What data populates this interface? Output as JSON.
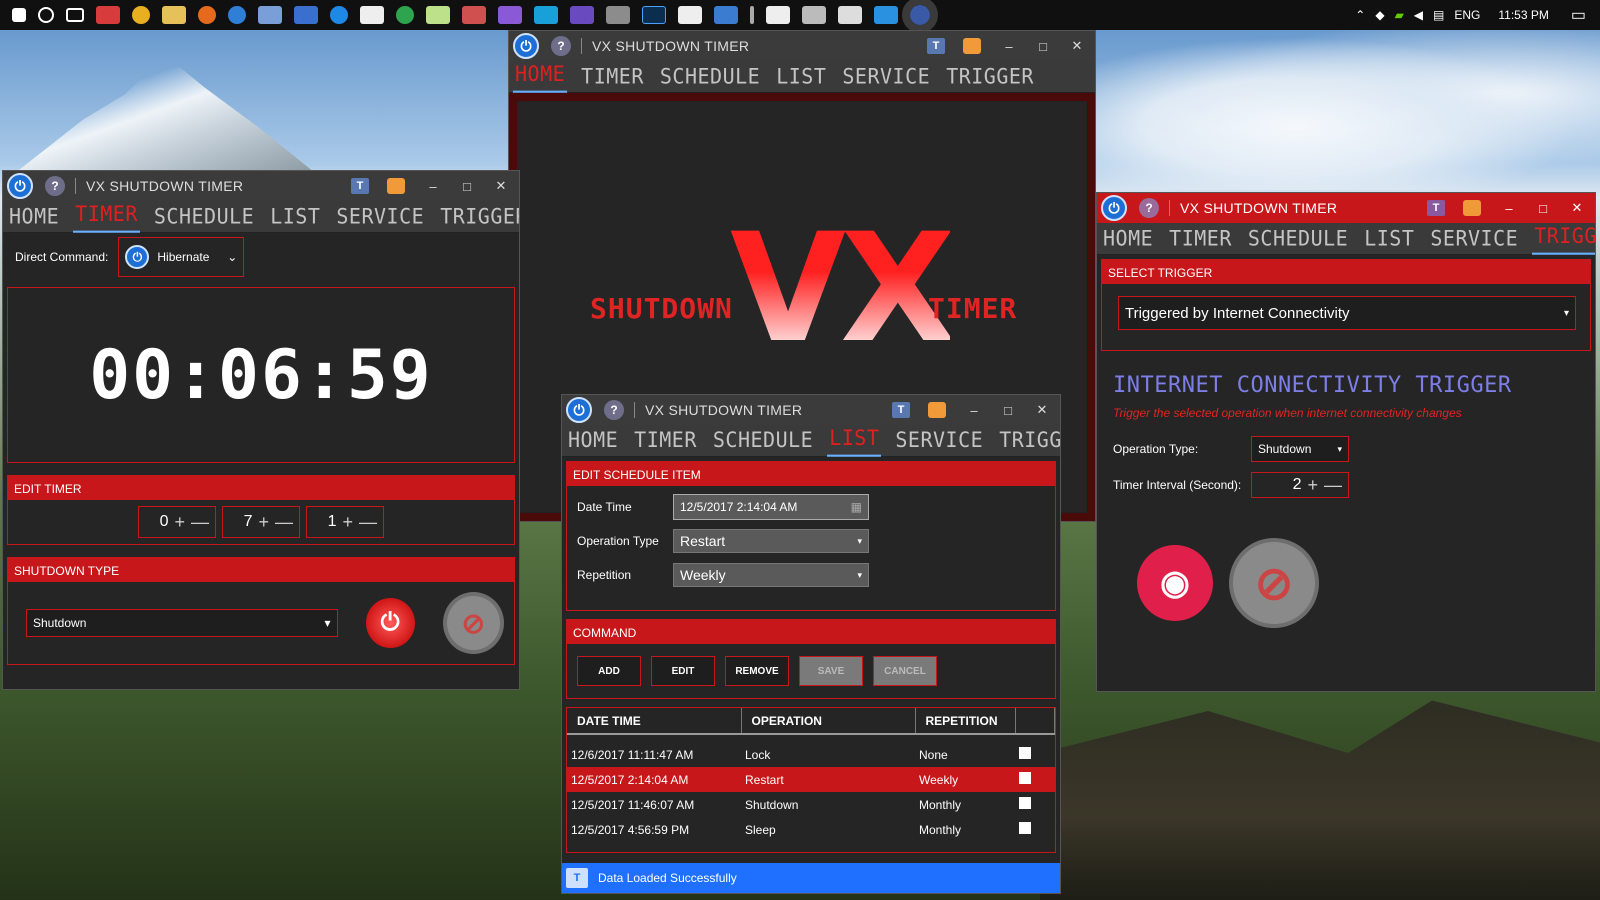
{
  "taskbar": {
    "lang": "ENG",
    "time": "11:53 PM"
  },
  "app": {
    "title": "VX SHUTDOWN TIMER",
    "nav": [
      "HOME",
      "TIMER",
      "SCHEDULE",
      "LIST",
      "SERVICE",
      "TRIGGER"
    ]
  },
  "timer_window": {
    "direct_command_label": "Direct Command:",
    "direct_command_value": "Hibernate",
    "clock": "00:06:59",
    "edit_timer_header": "EDIT TIMER",
    "hours": "0",
    "minutes": "7",
    "seconds": "1",
    "shutdown_type_header": "SHUTDOWN TYPE",
    "shutdown_type_value": "Shutdown"
  },
  "home_window": {
    "logo_left": "SHUTDOWN",
    "logo_center": "VX",
    "logo_right": "TIMER"
  },
  "list_window": {
    "edit_header": "EDIT SCHEDULE ITEM",
    "date_time_label": "Date Time",
    "date_time_value": "12/5/2017 2:14:04 AM",
    "operation_type_label": "Operation Type",
    "operation_type_value": "Restart",
    "repetition_label": "Repetition",
    "repetition_value": "Weekly",
    "command_header": "COMMAND",
    "buttons": {
      "add": "ADD",
      "edit": "EDIT",
      "remove": "REMOVE",
      "save": "SAVE",
      "cancel": "CANCEL"
    },
    "columns": [
      "DATE TIME",
      "OPERATION",
      "REPETITION"
    ],
    "rows": [
      {
        "date": "12/6/2017 11:11:47 AM",
        "op": "Lock",
        "rep": "None"
      },
      {
        "date": "12/5/2017 2:14:04 AM",
        "op": "Restart",
        "rep": "Weekly"
      },
      {
        "date": "12/5/2017 11:46:07 AM",
        "op": "Shutdown",
        "rep": "Monthly"
      },
      {
        "date": "12/5/2017 4:56:59 PM",
        "op": "Sleep",
        "rep": "Monthly"
      }
    ],
    "status": "Data Loaded Successfully"
  },
  "trigger_window": {
    "select_header": "SELECT TRIGGER",
    "select_value": "Triggered by Internet Connectivity",
    "heading": "INTERNET CONNECTIVITY TRIGGER",
    "subtitle": "Trigger the selected operation when internet connectivity changes",
    "op_type_label": "Operation Type:",
    "op_type_value": "Shutdown",
    "interval_label": "Timer Interval (Second):",
    "interval_value": "2"
  },
  "colors": {
    "accent": "#c8171a",
    "status": "#1f70ff",
    "heading": "#7d7ee6"
  }
}
